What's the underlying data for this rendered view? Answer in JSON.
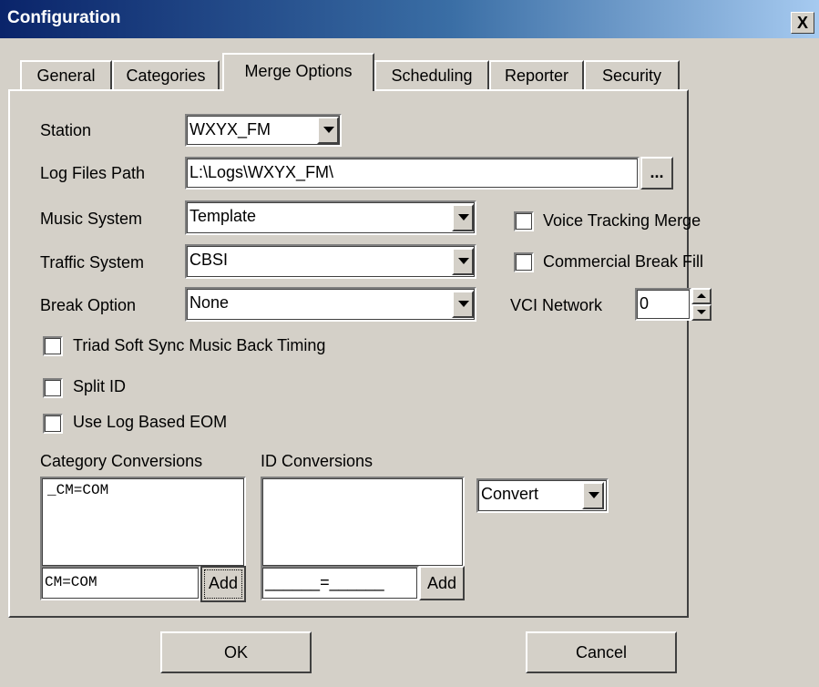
{
  "window": {
    "title": "Configuration",
    "close_glyph": "X"
  },
  "tabs": [
    {
      "label": "General"
    },
    {
      "label": "Categories"
    },
    {
      "label": "Merge Options",
      "active": true
    },
    {
      "label": "Scheduling"
    },
    {
      "label": "Reporter"
    },
    {
      "label": "Security"
    }
  ],
  "form": {
    "station": {
      "label": "Station",
      "value": "WXYX_FM"
    },
    "log_files_path": {
      "label": "Log Files Path",
      "value": "L:\\Logs\\WXYX_FM\\",
      "browse_label": "..."
    },
    "music_system": {
      "label": "Music System",
      "value": "Template"
    },
    "traffic_system": {
      "label": "Traffic System",
      "value": "CBSI"
    },
    "break_option": {
      "label": "Break Option",
      "value": "None"
    },
    "voice_tracking_merge": {
      "label": "Voice Tracking Merge",
      "checked": false
    },
    "commercial_break_fill": {
      "label": "Commercial Break Fill",
      "checked": false
    },
    "vci_network": {
      "label": "VCI Network",
      "value": "0"
    },
    "triad_soft_sync": {
      "label": "Triad Soft Sync Music Back Timing",
      "checked": false
    },
    "split_id": {
      "label": "Split ID",
      "checked": false
    },
    "use_log_based_eom": {
      "label": "Use Log Based EOM",
      "checked": false
    },
    "category_conversions": {
      "label": "Category Conversions",
      "items": [
        "_CM=COM"
      ],
      "input_value": "CM=COM",
      "add_label": "Add"
    },
    "id_conversions": {
      "label": "ID Conversions",
      "items": [],
      "input_value": "______=______",
      "add_label": "Add"
    },
    "convert_select": {
      "value": "Convert"
    }
  },
  "buttons": {
    "ok": "OK",
    "cancel": "Cancel"
  },
  "colors": {
    "face": "#d4d0c8",
    "title_start": "#0a246a",
    "title_end": "#a6caf0"
  }
}
